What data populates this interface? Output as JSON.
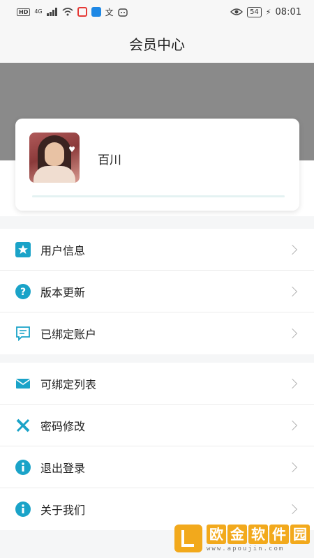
{
  "status_bar": {
    "hd": "HD",
    "network": "4G",
    "battery": "54",
    "time": "08:01"
  },
  "header": {
    "title": "会员中心"
  },
  "profile": {
    "username": "百川"
  },
  "menu": {
    "group1": [
      {
        "label": "用户信息",
        "icon": "star-icon"
      },
      {
        "label": "版本更新",
        "icon": "question-icon"
      },
      {
        "label": "已绑定账户",
        "icon": "message-icon"
      }
    ],
    "group2": [
      {
        "label": "可绑定列表",
        "icon": "mail-icon"
      },
      {
        "label": "密码修改",
        "icon": "ruler-pencil-icon"
      },
      {
        "label": "退出登录",
        "icon": "info-icon"
      },
      {
        "label": "关于我们",
        "icon": "info-icon"
      }
    ]
  },
  "watermark": {
    "chars": [
      "欧",
      "金",
      "软",
      "件",
      "园"
    ],
    "url": "www.apoujin.com"
  },
  "colors": {
    "accent": "#1aa3c8",
    "banner": "#8a8a8a",
    "watermark": "#f2a91c"
  }
}
